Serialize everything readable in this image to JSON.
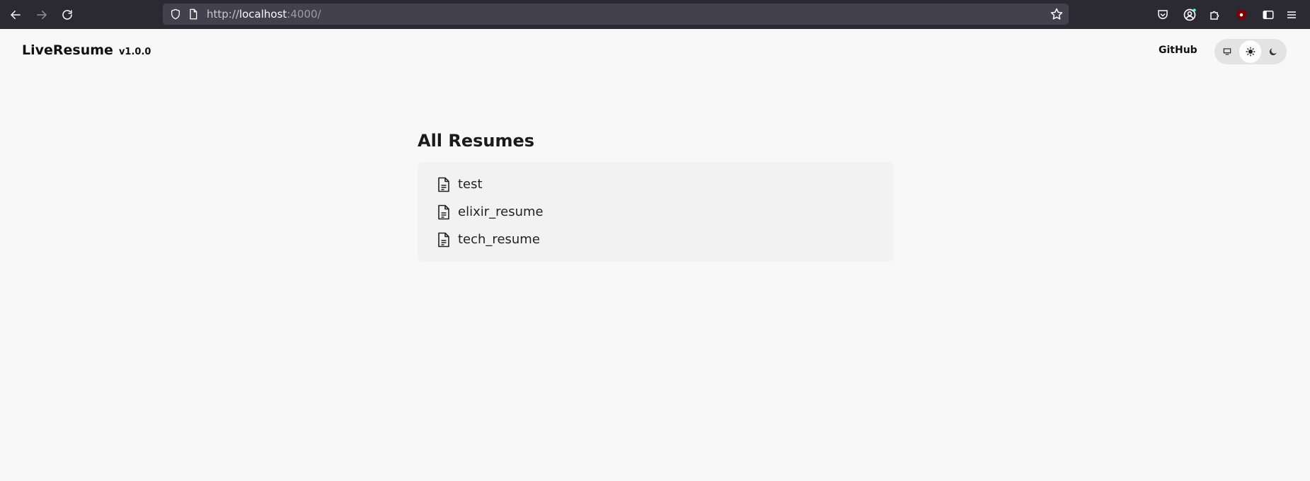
{
  "browser": {
    "url_scheme": "http://",
    "url_host": "localhost",
    "url_rest": ":4000/"
  },
  "header": {
    "brand": "LiveResume",
    "version": "v1.0.0",
    "github_label": "GitHub",
    "theme_options": [
      "system-icon",
      "sun-icon",
      "moon-icon"
    ],
    "active_theme": "light"
  },
  "main": {
    "title": "All Resumes",
    "resumes": [
      {
        "name": "test"
      },
      {
        "name": "elixir_resume"
      },
      {
        "name": "tech_resume"
      }
    ]
  }
}
